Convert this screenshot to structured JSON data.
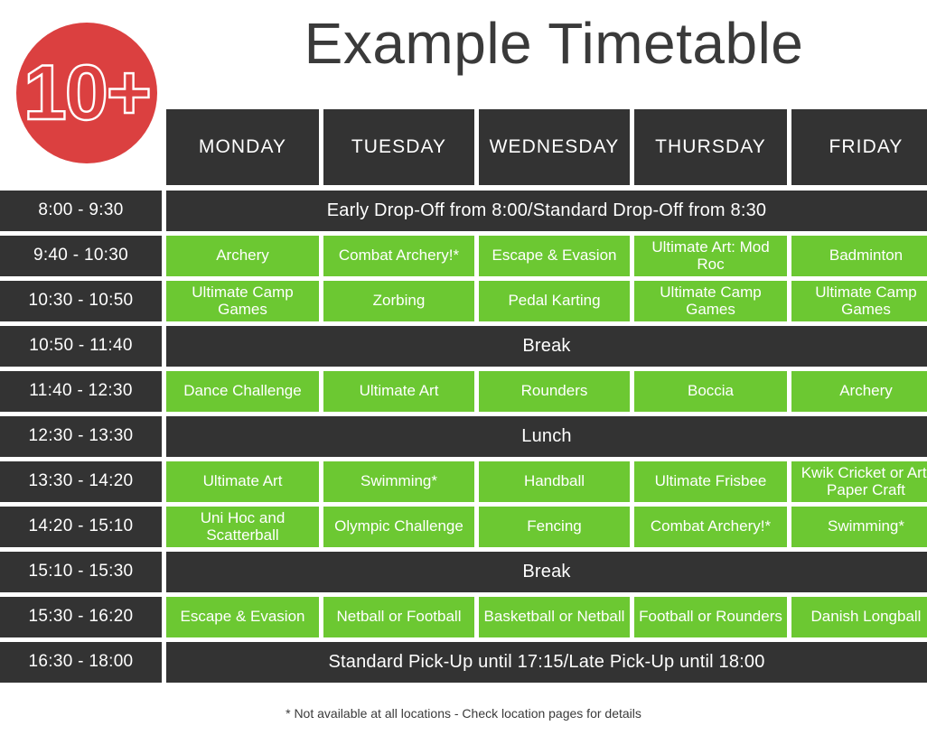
{
  "header": {
    "title": "Example Timetable",
    "age_badge": "10+"
  },
  "days": [
    "MONDAY",
    "TUESDAY",
    "WEDNESDAY",
    "THURSDAY",
    "FRIDAY"
  ],
  "colors": {
    "activity_green": "#6cc832",
    "dark": "#333333",
    "badge_red": "#db4040",
    "text_light": "#ffffff",
    "title_dark": "#3a3a3a"
  },
  "rows": [
    {
      "time": "8:00 - 9:30",
      "type": "span",
      "text": "Early Drop-Off from 8:00/Standard Drop-Off from 8:30"
    },
    {
      "time": "9:40 - 10:30",
      "type": "activities",
      "cells": [
        "Archery",
        "Combat Archery!*",
        "Escape & Evasion",
        "Ultimate Art: Mod Roc",
        "Badminton"
      ]
    },
    {
      "time": "10:30 - 10:50",
      "type": "activities",
      "cells": [
        "Ultimate Camp Games",
        "Zorbing",
        "Pedal Karting",
        "Ultimate Camp Games",
        "Ultimate Camp Games"
      ]
    },
    {
      "time": "10:50 - 11:40",
      "type": "span",
      "text": "Break"
    },
    {
      "time": "11:40 - 12:30",
      "type": "activities",
      "cells": [
        "Dance Challenge",
        "Ultimate Art",
        "Rounders",
        "Boccia",
        "Archery"
      ]
    },
    {
      "time": "12:30 - 13:30",
      "type": "span",
      "text": "Lunch"
    },
    {
      "time": "13:30 - 14:20",
      "type": "activities",
      "cells": [
        "Ultimate Art",
        "Swimming*",
        "Handball",
        "Ultimate Frisbee",
        "Kwik Cricket or Art: Paper Craft"
      ]
    },
    {
      "time": "14:20 - 15:10",
      "type": "activities",
      "cells": [
        "Uni Hoc and Scatterball",
        "Olympic Challenge",
        "Fencing",
        "Combat Archery!*",
        "Swimming*"
      ]
    },
    {
      "time": "15:10 - 15:30",
      "type": "span",
      "text": "Break"
    },
    {
      "time": "15:30 - 16:20",
      "type": "activities",
      "cells": [
        "Escape & Evasion",
        "Netball or Football",
        "Basketball or Netball",
        "Football or Rounders",
        "Danish Longball"
      ]
    },
    {
      "time": "16:30 - 18:00",
      "type": "span",
      "text": "Standard Pick-Up until 17:15/Late Pick-Up until 18:00"
    }
  ],
  "footnote": "* Not available at all locations - Check location pages for details"
}
